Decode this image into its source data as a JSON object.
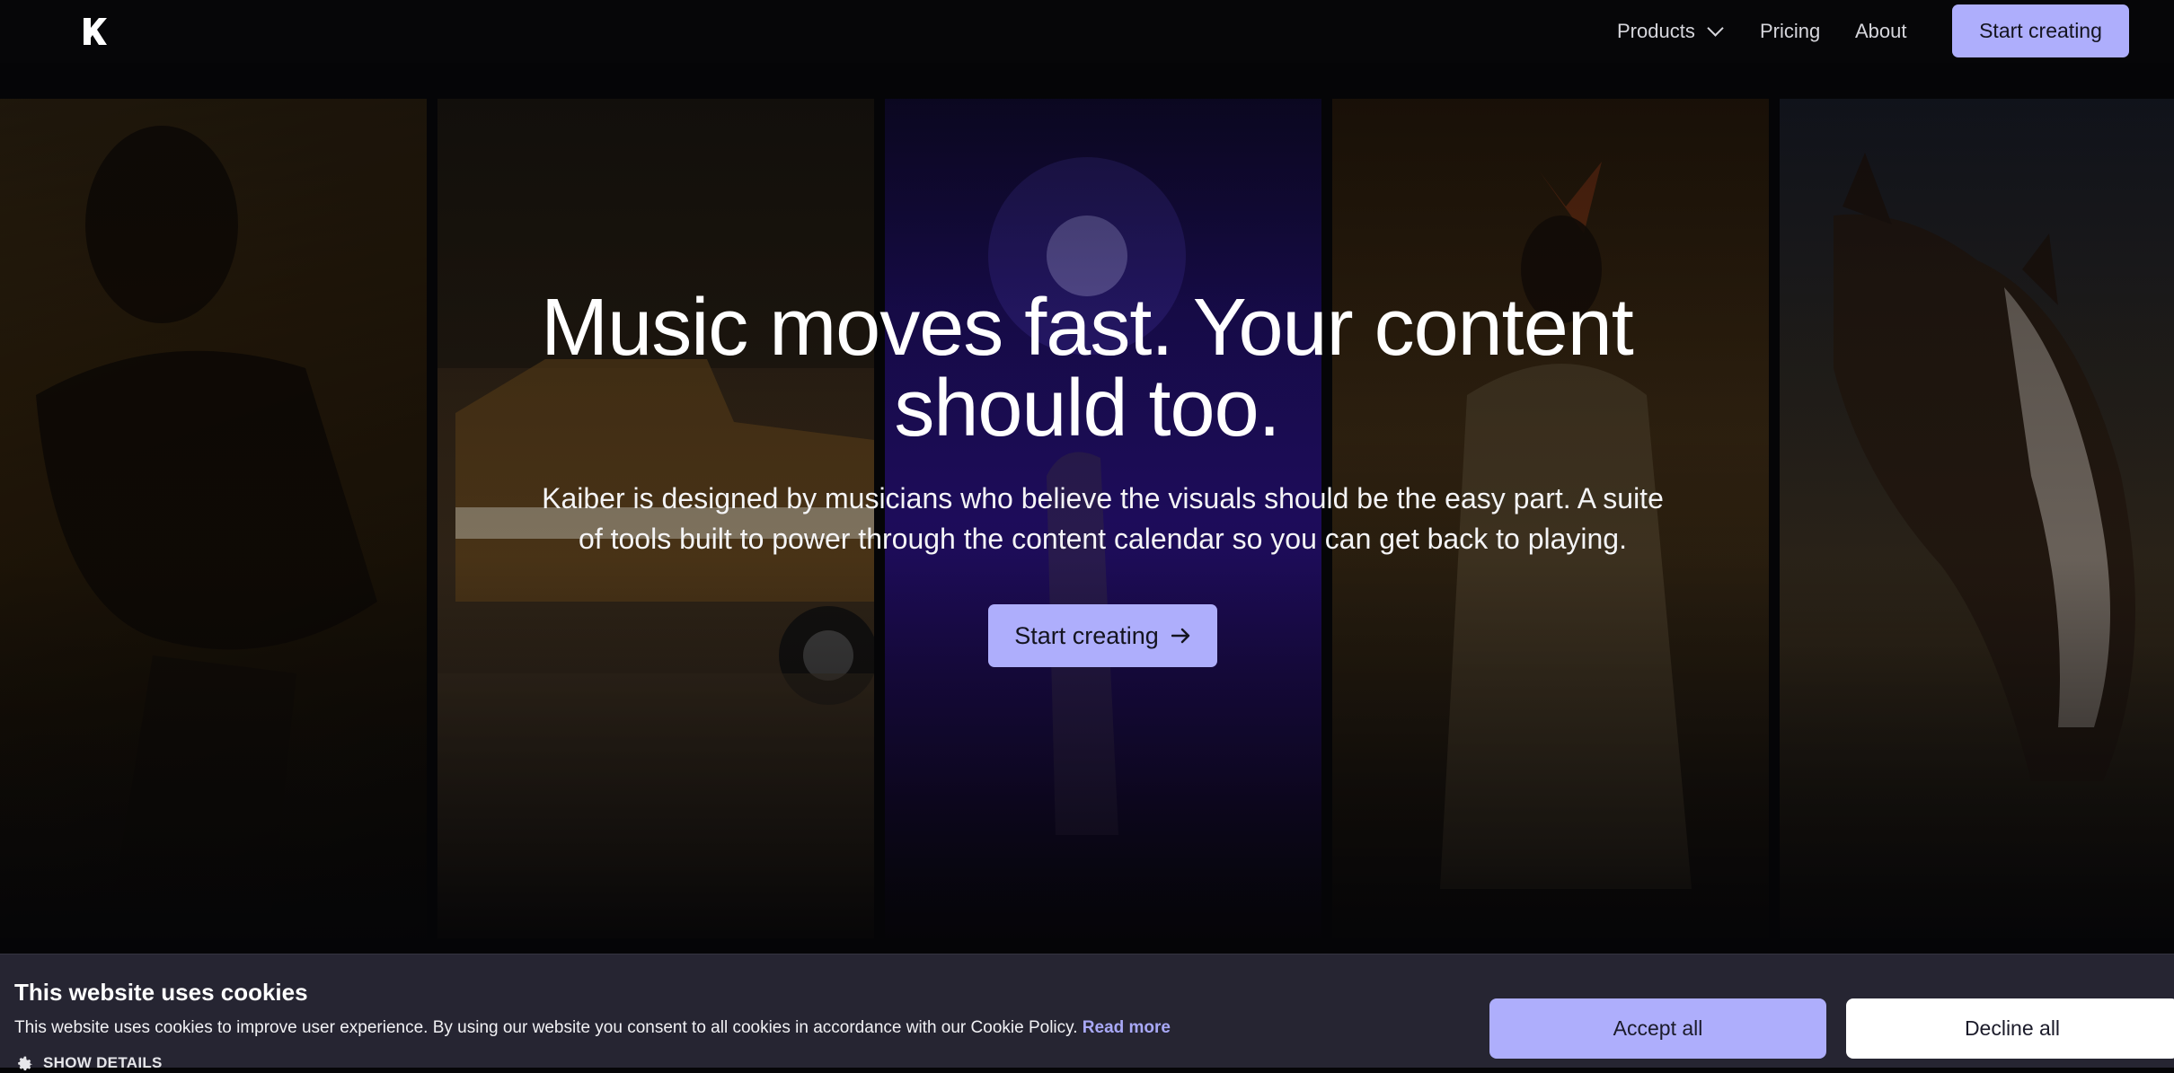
{
  "nav": {
    "logo_letter": "K",
    "products_label": "Products",
    "pricing_label": "Pricing",
    "about_label": "About",
    "cta_label": "Start creating"
  },
  "hero": {
    "title": "Music moves fast. Your content should too.",
    "subtitle": "Kaiber is designed by musicians who believe the visuals should be the easy part. A suite of tools built to power through the content calendar so you can get back to playing.",
    "cta_label": "Start creating"
  },
  "cookie": {
    "title": "This website uses cookies",
    "text": "This website uses cookies to improve user experience. By using our website you consent to all cookies in accordance with our Cookie Policy.",
    "read_more_label": "Read more",
    "show_details_label": "SHOW DETAILS",
    "accept_label": "Accept all",
    "decline_label": "Decline all"
  },
  "colors": {
    "accent": "#aeaefc",
    "background": "#050507",
    "cookie_bar": "#262532"
  },
  "icons": {
    "logo": "kaiber-logo-icon",
    "products_menu": "chevron-down-icon",
    "hero_cta": "arrow-right-icon",
    "show_details": "gear-icon"
  }
}
